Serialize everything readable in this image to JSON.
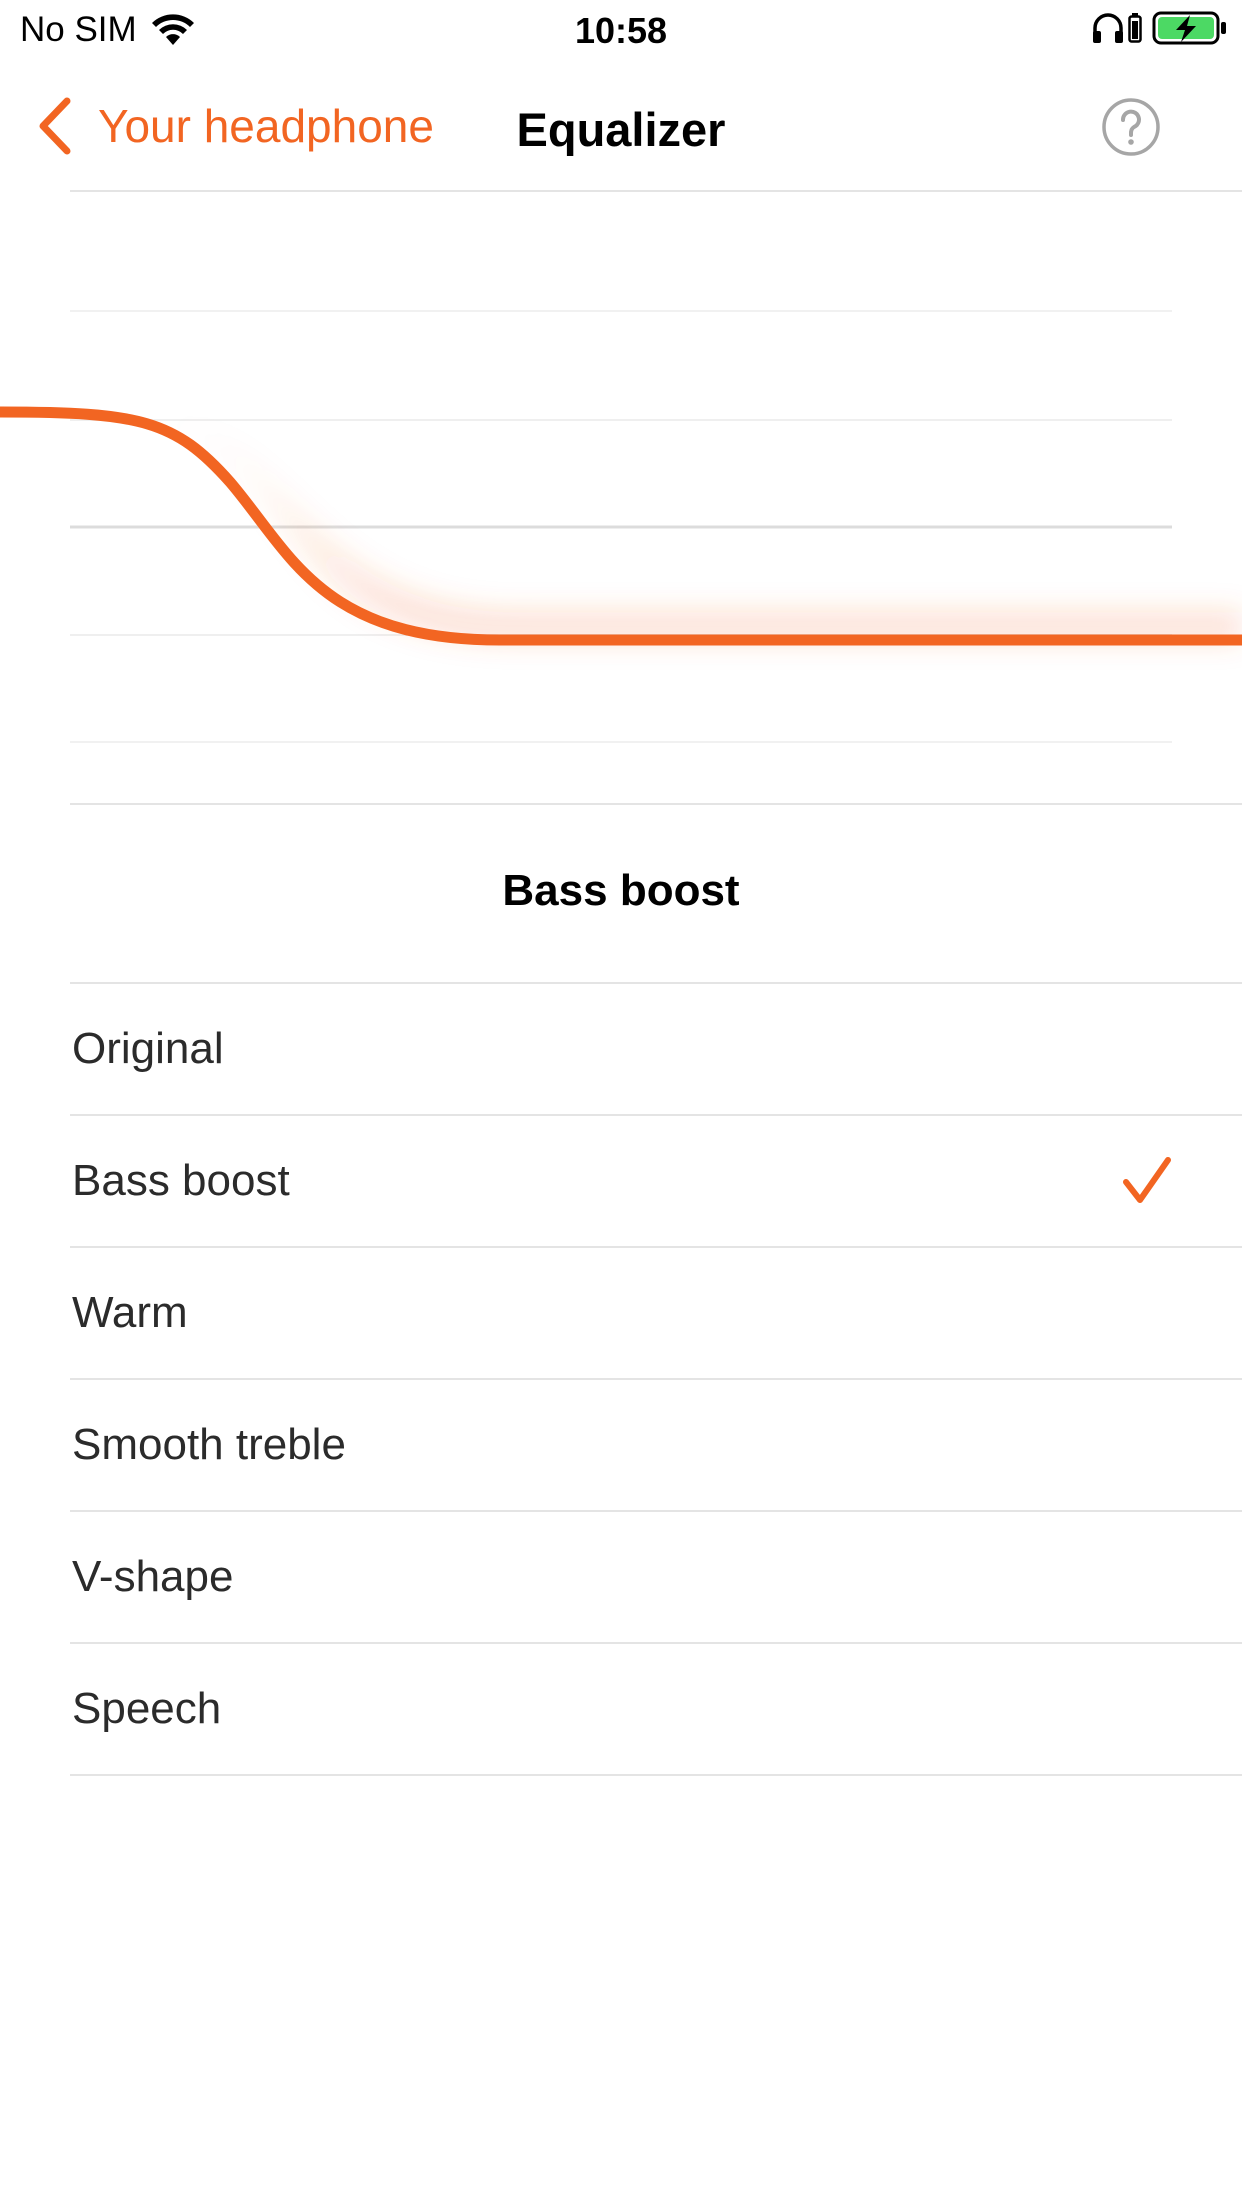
{
  "status_bar": {
    "carrier": "No SIM",
    "time": "10:58",
    "icons": [
      "wifi-icon",
      "headphone-icon",
      "battery-charging-icon"
    ],
    "battery_color": "#4cd964"
  },
  "nav": {
    "back_label": "Your headphone",
    "title": "Equalizer",
    "help_icon": "question-circle-icon"
  },
  "theme": {
    "accent": "#f26522",
    "divider": "#e4e4e4"
  },
  "equalizer": {
    "preset_title": "Bass boost",
    "curve_shape": "bass-boost: elevated low frequencies sloping down to a flat lower level"
  },
  "presets": [
    {
      "label": "Original",
      "selected": false
    },
    {
      "label": "Bass boost",
      "selected": true
    },
    {
      "label": "Warm",
      "selected": false
    },
    {
      "label": "Smooth treble",
      "selected": false
    },
    {
      "label": "V-shape",
      "selected": false
    },
    {
      "label": "Speech",
      "selected": false
    }
  ]
}
